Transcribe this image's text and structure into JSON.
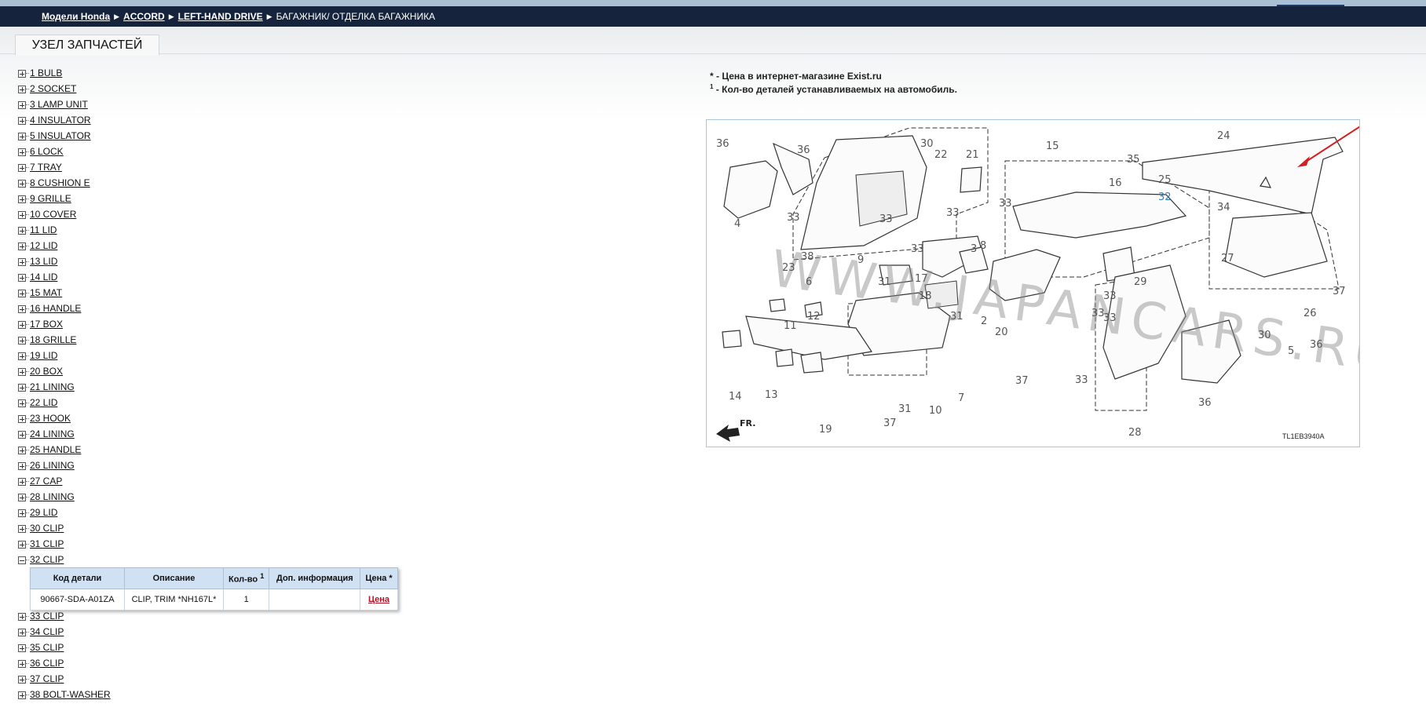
{
  "breadcrumb": {
    "items": [
      "Модели Honda",
      "ACCORD",
      "LEFT-HAND DRIVE"
    ],
    "current": "БАГАЖНИК/ ОТДЕЛКА БАГАЖНИКА"
  },
  "tab": {
    "label": "УЗЕЛ ЗАПЧАСТЕЙ"
  },
  "notes": {
    "line1": "* - Цена в интернет-магазине Exist.ru",
    "sup": "1",
    "line2": " - Кол-во деталей устанавливаемых на автомобиль."
  },
  "parts_tree": [
    {
      "label": "1 BULB",
      "expanded": false
    },
    {
      "label": "2 SOCKET",
      "expanded": false
    },
    {
      "label": "3 LAMP UNIT",
      "expanded": false
    },
    {
      "label": "4 INSULATOR",
      "expanded": false
    },
    {
      "label": "5 INSULATOR",
      "expanded": false
    },
    {
      "label": "6 LOCK",
      "expanded": false
    },
    {
      "label": "7 TRAY",
      "expanded": false
    },
    {
      "label": "8 CUSHION E",
      "expanded": false
    },
    {
      "label": "9 GRILLE",
      "expanded": false
    },
    {
      "label": "10 COVER",
      "expanded": false
    },
    {
      "label": "11 LID",
      "expanded": false
    },
    {
      "label": "12 LID",
      "expanded": false
    },
    {
      "label": "13 LID",
      "expanded": false
    },
    {
      "label": "14 LID",
      "expanded": false
    },
    {
      "label": "15 MAT",
      "expanded": false
    },
    {
      "label": "16 HANDLE",
      "expanded": false
    },
    {
      "label": "17 BOX",
      "expanded": false
    },
    {
      "label": "18 GRILLE",
      "expanded": false
    },
    {
      "label": "19 LID",
      "expanded": false
    },
    {
      "label": "20 BOX",
      "expanded": false
    },
    {
      "label": "21 LINING",
      "expanded": false
    },
    {
      "label": "22 LID",
      "expanded": false
    },
    {
      "label": "23 HOOK",
      "expanded": false
    },
    {
      "label": "24 LINING",
      "expanded": false
    },
    {
      "label": "25 HANDLE",
      "expanded": false
    },
    {
      "label": "26 LINING",
      "expanded": false
    },
    {
      "label": "27 CAP",
      "expanded": false
    },
    {
      "label": "28 LINING",
      "expanded": false
    },
    {
      "label": "29 LID",
      "expanded": false
    },
    {
      "label": "30 CLIP",
      "expanded": false
    },
    {
      "label": "31 CLIP",
      "expanded": false
    },
    {
      "label": "32 CLIP",
      "expanded": true
    },
    {
      "label": "33 CLIP",
      "expanded": false
    },
    {
      "label": "34 CLIP",
      "expanded": false
    },
    {
      "label": "35 CLIP",
      "expanded": false
    },
    {
      "label": "36 CLIP",
      "expanded": false
    },
    {
      "label": "37 CLIP",
      "expanded": false
    },
    {
      "label": "38 BOLT-WASHER",
      "expanded": false
    }
  ],
  "parts_table": {
    "headers": [
      "Код детали",
      "Описание",
      "Кол-во",
      "Доп. информация",
      "Цена *"
    ],
    "qty_sup": "1",
    "rows": [
      {
        "code": "90667-SDA-A01ZA",
        "description": "CLIP, TRIM *NH167L*",
        "qty": "1",
        "info": "",
        "price_link": "Цена"
      }
    ]
  },
  "diagram": {
    "code": "TL1EB3940A",
    "watermark": "WWW.JAPANCARS.RU",
    "direction_label": "FR.",
    "highlighted_part": "32",
    "annotation_color": "#d21f1f",
    "callouts": [
      "36",
      "36",
      "30",
      "22",
      "21",
      "15",
      "24",
      "35",
      "25",
      "32",
      "34",
      "16",
      "33",
      "33",
      "33",
      "33",
      "4",
      "33",
      "38",
      "9",
      "23",
      "6",
      "31",
      "3",
      "8",
      "17",
      "18",
      "31",
      "2",
      "20",
      "29",
      "27",
      "37",
      "26",
      "33",
      "11",
      "12",
      "33",
      "33",
      "30",
      "5",
      "36",
      "14",
      "13",
      "19",
      "31",
      "10",
      "37",
      "7",
      "37",
      "33",
      "36",
      "28"
    ]
  }
}
